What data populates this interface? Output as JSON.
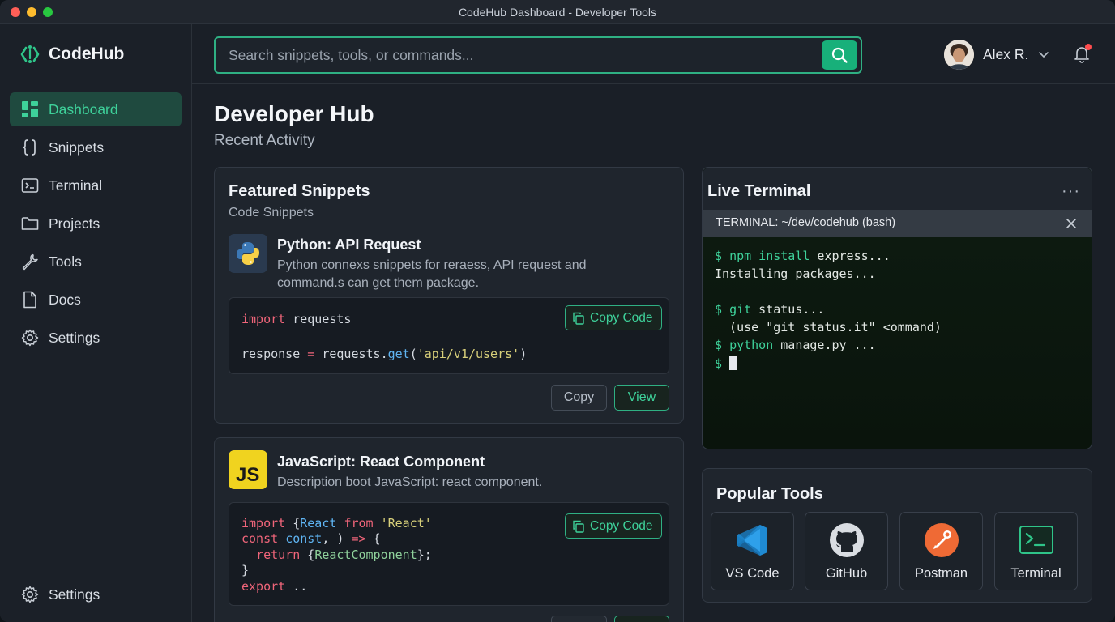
{
  "window": {
    "title": "CodeHub Dashboard - Developer Tools"
  },
  "sidebar": {
    "logo": "CodeHub",
    "items": [
      {
        "label": "Dashboard",
        "icon": "dashboard-icon",
        "active": true
      },
      {
        "label": "Snippets",
        "icon": "snippets-icon"
      },
      {
        "label": "Terminal",
        "icon": "terminal-icon"
      },
      {
        "label": "Projects",
        "icon": "folder-icon"
      },
      {
        "label": "Tools",
        "icon": "wrench-icon"
      },
      {
        "label": "Docs",
        "icon": "document-icon"
      },
      {
        "label": "Settings",
        "icon": "gear-icon"
      }
    ],
    "bottom_item": {
      "label": "Settings",
      "icon": "gear-icon"
    }
  },
  "topbar": {
    "search_placeholder": "Search snippets, tools, or commands...",
    "user_name": "Alex R.",
    "notifications_unread": true
  },
  "page": {
    "title": "Developer Hub",
    "subtitle": "Recent Activity"
  },
  "featured": {
    "title": "Featured Snippets",
    "subtitle": "Code Snippets",
    "snippets": [
      {
        "title": "Python: API Request",
        "desc_line1": "Python connexs snippets for reraess, API request and",
        "desc_line2": "command.s can get them package.",
        "copy_code": "Copy Code",
        "code_lines": [
          "import requests",
          "",
          "response = requests.get('api/v1/users')"
        ],
        "copy_label": "Copy",
        "view_label": "View"
      },
      {
        "title": "JavaScript: React Component",
        "desc": "Description boot JavaScript: react component.",
        "icon_text": "JS",
        "copy_code": "Copy Code",
        "code_lines": [
          "import {React from 'React'",
          "const const, ) => {",
          "  return {ReactComponent};",
          "}",
          "export .."
        ]
      }
    ]
  },
  "terminal": {
    "title": "Live Terminal",
    "more": "···",
    "tab": "TERMINAL: ~/dev/codehub (bash)",
    "lines": [
      "$ npm install express...",
      "Installing packages...",
      "",
      "$ git status...",
      "  (use \"git status.it\" <ommand)",
      "$ python manage.py ...",
      "$ "
    ]
  },
  "tools": {
    "title": "Popular Tools",
    "items": [
      {
        "label": "VS Code",
        "icon": "vscode-icon"
      },
      {
        "label": "GitHub",
        "icon": "github-icon"
      },
      {
        "label": "Postman",
        "icon": "postman-icon"
      },
      {
        "label": "Terminal",
        "icon": "terminal-app-icon"
      }
    ]
  },
  "colors": {
    "accent": "#18b07a",
    "accent_text": "#3ed19a",
    "background": "#1a1f27",
    "card": "#1f252d"
  }
}
